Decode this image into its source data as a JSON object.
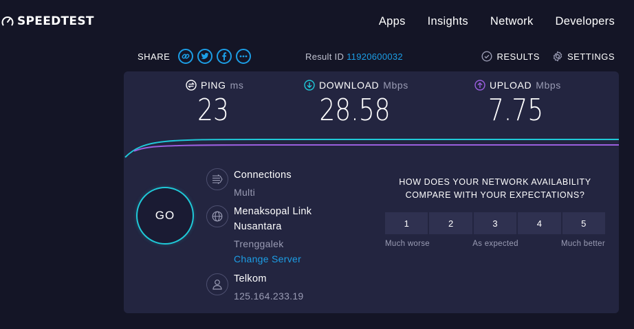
{
  "brand": {
    "name": "SPEEDTEST"
  },
  "nav": {
    "items": [
      "Apps",
      "Insights",
      "Network",
      "Developers"
    ]
  },
  "share": {
    "label": "SHARE"
  },
  "result": {
    "label": "Result ID",
    "id": "11920600032"
  },
  "actions": {
    "results": "RESULTS",
    "settings": "SETTINGS"
  },
  "metrics": {
    "ping": {
      "label": "PING",
      "unit": "ms",
      "value": "23"
    },
    "download": {
      "label": "DOWNLOAD",
      "unit": "Mbps",
      "value": "28.58"
    },
    "upload": {
      "label": "UPLOAD",
      "unit": "Mbps",
      "value": "7.75"
    }
  },
  "go": {
    "label": "GO"
  },
  "connections": {
    "title": "Connections",
    "value": "Multi"
  },
  "server": {
    "name_line1": "Menaksopal Link",
    "name_line2": "Nusantara",
    "location": "Trenggalek",
    "change": "Change Server"
  },
  "isp": {
    "name": "Telkom",
    "ip": "125.164.233.19"
  },
  "survey": {
    "question_line1": "HOW DOES YOUR NETWORK AVAILABILITY",
    "question_line2": "COMPARE WITH YOUR EXPECTATIONS?",
    "options": [
      "1",
      "2",
      "3",
      "4",
      "5"
    ],
    "scale_low": "Much worse",
    "scale_mid": "As expected",
    "scale_high": "Much better"
  },
  "colors": {
    "accent": "#1c9ee6",
    "download": "#1fc9d8",
    "upload": "#9b5fe0",
    "panel": "#232540",
    "background": "#141526"
  }
}
